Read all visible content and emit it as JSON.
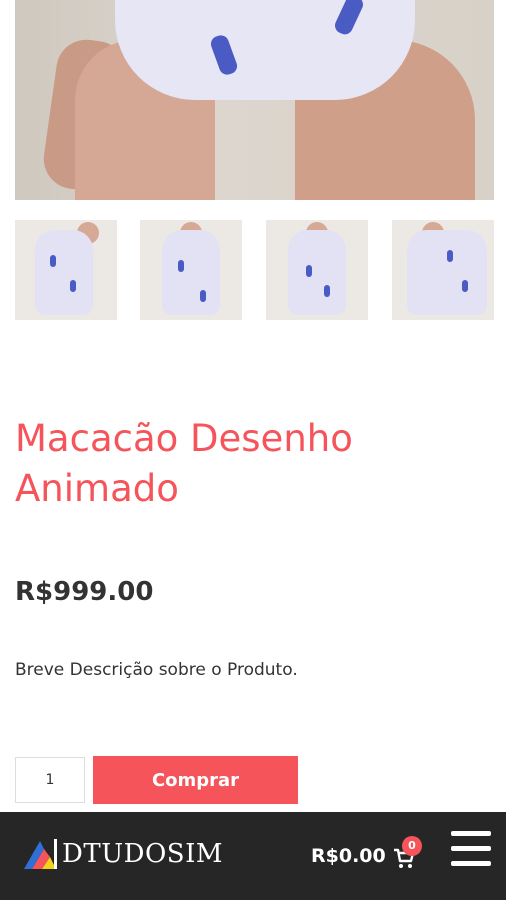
{
  "product": {
    "title": "Macacão Desenho Animado",
    "price": "R$999.00",
    "short_description": "Breve Descrição sobre o Produto.",
    "quantity": "1",
    "buy_label": "Comprar",
    "main_image": "product-photo",
    "thumbnails": [
      "thumbnail-1",
      "thumbnail-2",
      "thumbnail-3",
      "thumbnail-4"
    ]
  },
  "footer": {
    "logo_text": "DTUDOSIM",
    "cart_total": "R$0.00",
    "cart_count": "0",
    "cart_icon": "cart-icon",
    "menu_icon": "hamburger-menu-icon"
  },
  "colors": {
    "accent": "#f4545a",
    "text": "#333333",
    "footer_bg": "#262626"
  }
}
